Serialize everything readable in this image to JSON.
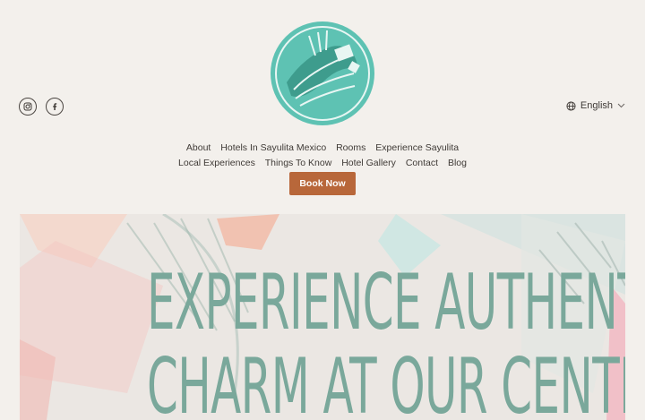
{
  "header": {
    "social": [
      {
        "name": "instagram-icon"
      },
      {
        "name": "facebook-icon"
      }
    ],
    "language_label": "English"
  },
  "nav": {
    "row1": [
      "About",
      "Hotels In Sayulita Mexico",
      "Rooms",
      "Experience Sayulita"
    ],
    "row2": [
      "Local Experiences",
      "Things To Know",
      "Hotel Gallery",
      "Contact",
      "Blog"
    ],
    "book_button": "Book Now"
  },
  "hero": {
    "line1": "EXPERIENCE AUTHENTIC SAYULITA",
    "line2": "CHARM AT OUR CENTRAL HOTEL"
  },
  "colors": {
    "background": "#f3f0ec",
    "accent": "#b8673a",
    "logo_teal": "#5ec2b3",
    "hero_text": "#7aa89b"
  }
}
